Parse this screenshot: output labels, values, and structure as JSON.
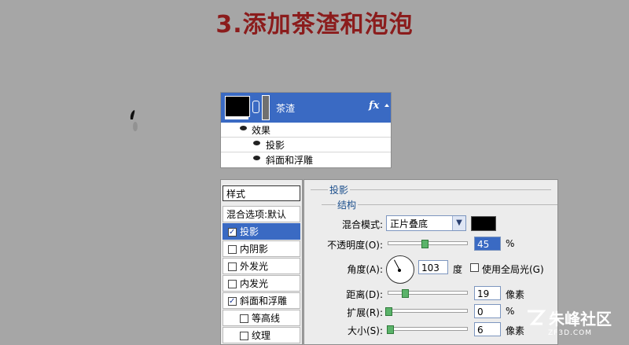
{
  "title": "3.添加茶渣和泡泡",
  "layers": {
    "layer_name": "茶渣",
    "fx_label": "fx",
    "effects_label": "效果",
    "effect_items": [
      "投影",
      "斜面和浮雕"
    ]
  },
  "styles": {
    "header": "样式",
    "blend_options": "混合选项:默认",
    "items": [
      {
        "label": "投影",
        "checked": true,
        "selected": true
      },
      {
        "label": "内阴影",
        "checked": false
      },
      {
        "label": "外发光",
        "checked": false
      },
      {
        "label": "内发光",
        "checked": false
      },
      {
        "label": "斜面和浮雕",
        "checked": true
      },
      {
        "label": "等高线",
        "checked": false
      },
      {
        "label": "纹理",
        "checked": false
      }
    ]
  },
  "settings": {
    "section_title": "投影",
    "subsection_title": "结构",
    "blend_mode_label": "混合模式:",
    "blend_mode_value": "正片叠底",
    "shadow_color": "#000000",
    "opacity_label": "不透明度(O):",
    "opacity_value": "45",
    "opacity_unit": "%",
    "angle_label": "角度(A):",
    "angle_value": "103",
    "angle_unit": "度",
    "global_light_label": "使用全局光(G)",
    "distance_label": "距离(D):",
    "distance_value": "19",
    "distance_unit": "像素",
    "spread_label": "扩展(R):",
    "spread_value": "0",
    "spread_unit": "%",
    "size_label": "大小(S):",
    "size_value": "6",
    "size_unit": "像素"
  },
  "watermark": {
    "text": "朱峰社区",
    "sub": "ZF3D.COM"
  }
}
